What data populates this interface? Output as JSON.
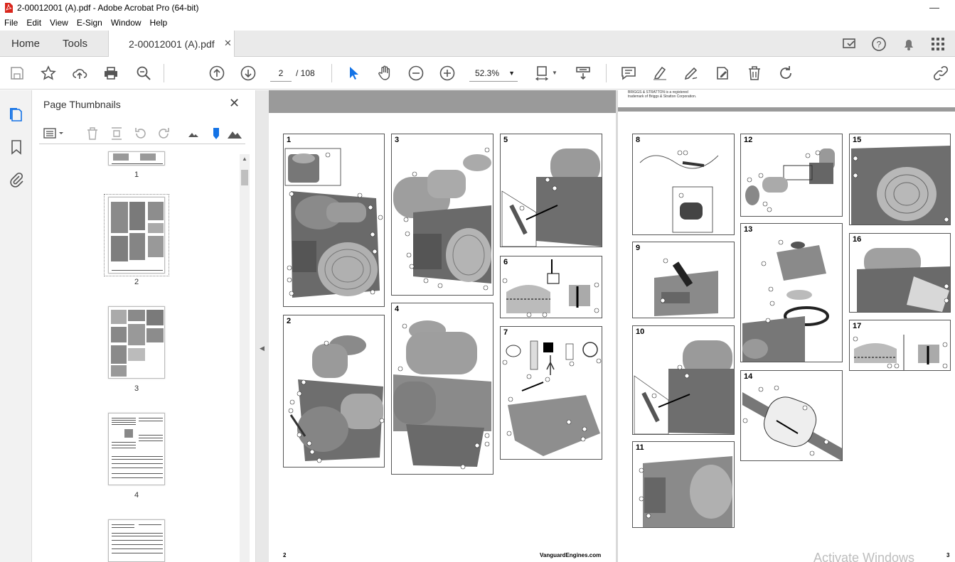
{
  "window": {
    "title": "2-00012001 (A).pdf - Adobe Acrobat Pro (64-bit)"
  },
  "menu": [
    "File",
    "Edit",
    "View",
    "E-Sign",
    "Window",
    "Help"
  ],
  "tabs": {
    "home": "Home",
    "tools": "Tools",
    "document": "2-00012001 (A).pdf"
  },
  "toolbar": {
    "current_page": "2",
    "total_pages": "/ 108",
    "zoom": "52.3%"
  },
  "thumbnails": {
    "title": "Page Thumbnails",
    "pages": [
      "1",
      "2",
      "3",
      "4"
    ]
  },
  "document": {
    "left_page_number": "2",
    "right_page_number": "3",
    "website": "VanguardEngines.com",
    "trademark_line1": "BRIGGS & STRATTON is a registered",
    "trademark_line2": "trademark of Briggs & Stratton Corporation.",
    "left_figures": [
      "1",
      "2",
      "3",
      "4",
      "5",
      "6",
      "7"
    ],
    "right_figures": [
      "8",
      "9",
      "10",
      "11",
      "12",
      "13",
      "14",
      "15",
      "16",
      "17"
    ]
  },
  "watermark": "Activate Windows",
  "colors": {
    "accent_blue": "#1473e6",
    "tab_bg": "#eaeaea"
  }
}
